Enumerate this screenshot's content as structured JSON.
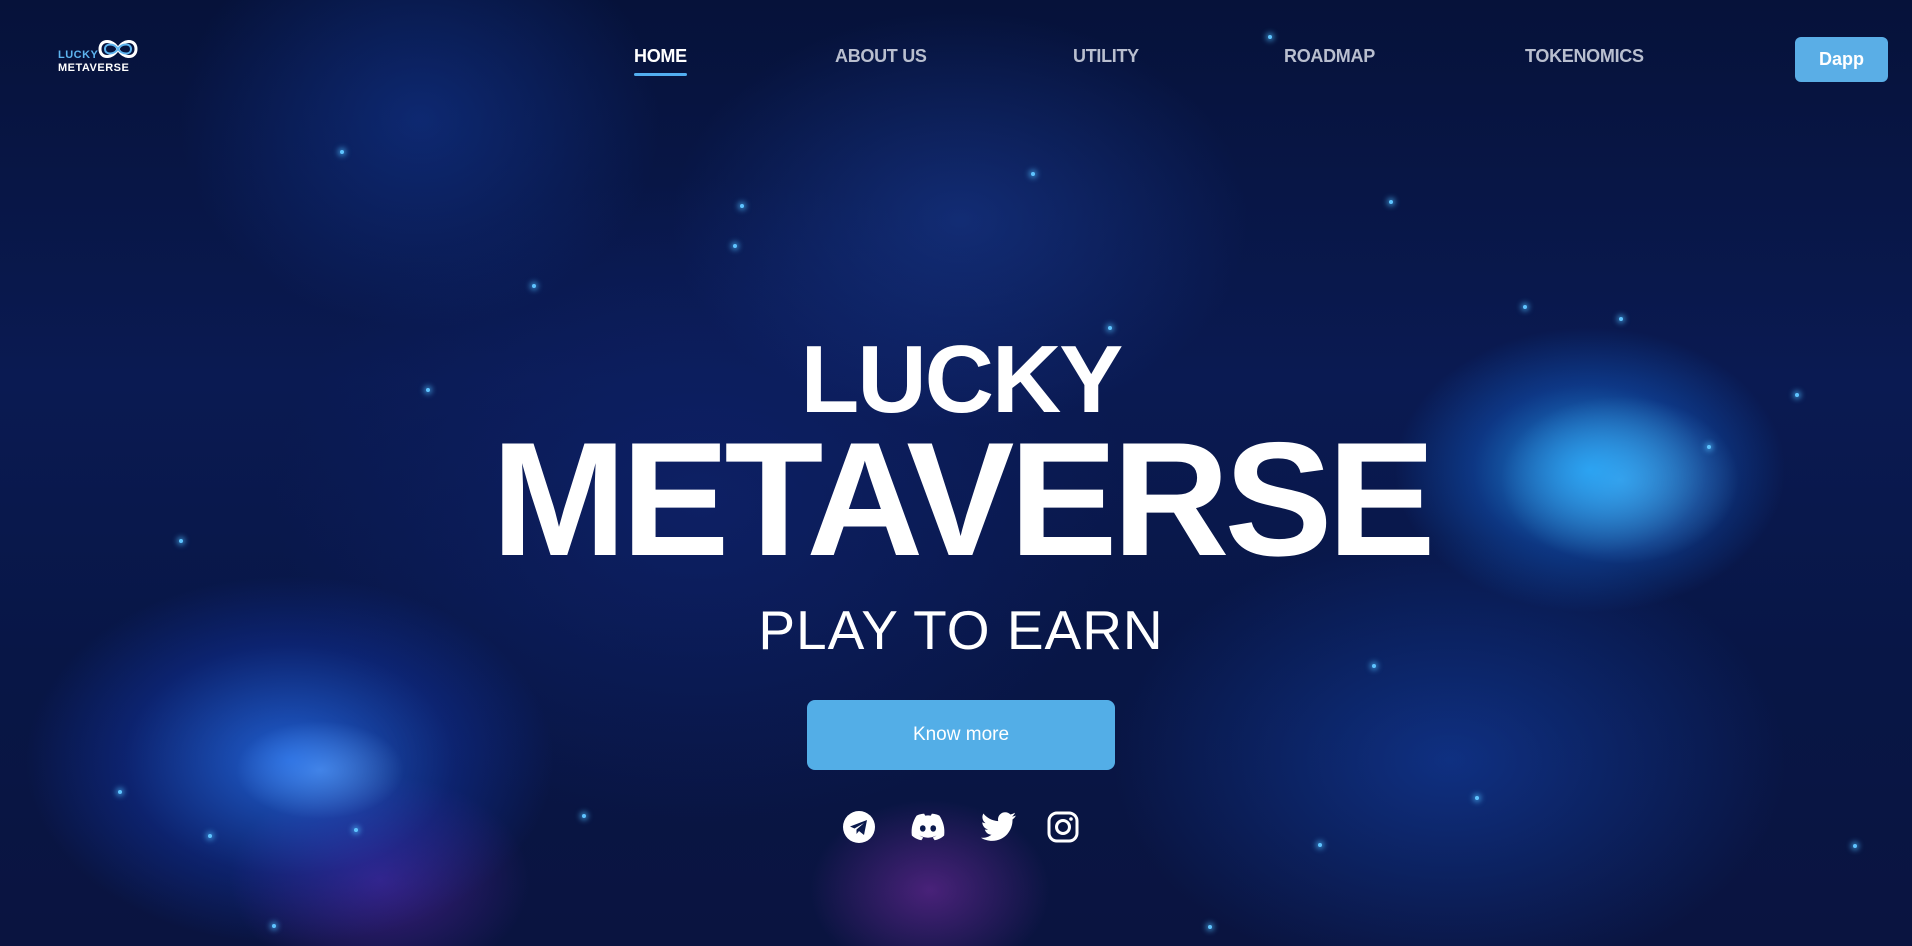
{
  "brand": {
    "logo_top": "LUCKY",
    "logo_bottom": "METAVERSE"
  },
  "nav": {
    "items": [
      {
        "label": "HOME",
        "active": true
      },
      {
        "label": "ABOUT US",
        "active": false
      },
      {
        "label": "UTILITY",
        "active": false
      },
      {
        "label": "ROADMAP",
        "active": false
      },
      {
        "label": "TOKENOMICS",
        "active": false
      }
    ],
    "dapp_label": "Dapp"
  },
  "hero": {
    "title_line1": "LUCKY",
    "title_line2": "METAVERSE",
    "subtitle": "PLAY TO EARN",
    "cta_label": "Know more"
  },
  "socials": [
    {
      "name": "telegram",
      "icon": "telegram-icon"
    },
    {
      "name": "discord",
      "icon": "discord-icon"
    },
    {
      "name": "twitter",
      "icon": "twitter-icon"
    },
    {
      "name": "instagram",
      "icon": "instagram-icon"
    }
  ],
  "colors": {
    "accent": "#53aee7",
    "background": "#06123a",
    "nav_inactive": "#b9bfcf",
    "text": "#ffffff"
  }
}
